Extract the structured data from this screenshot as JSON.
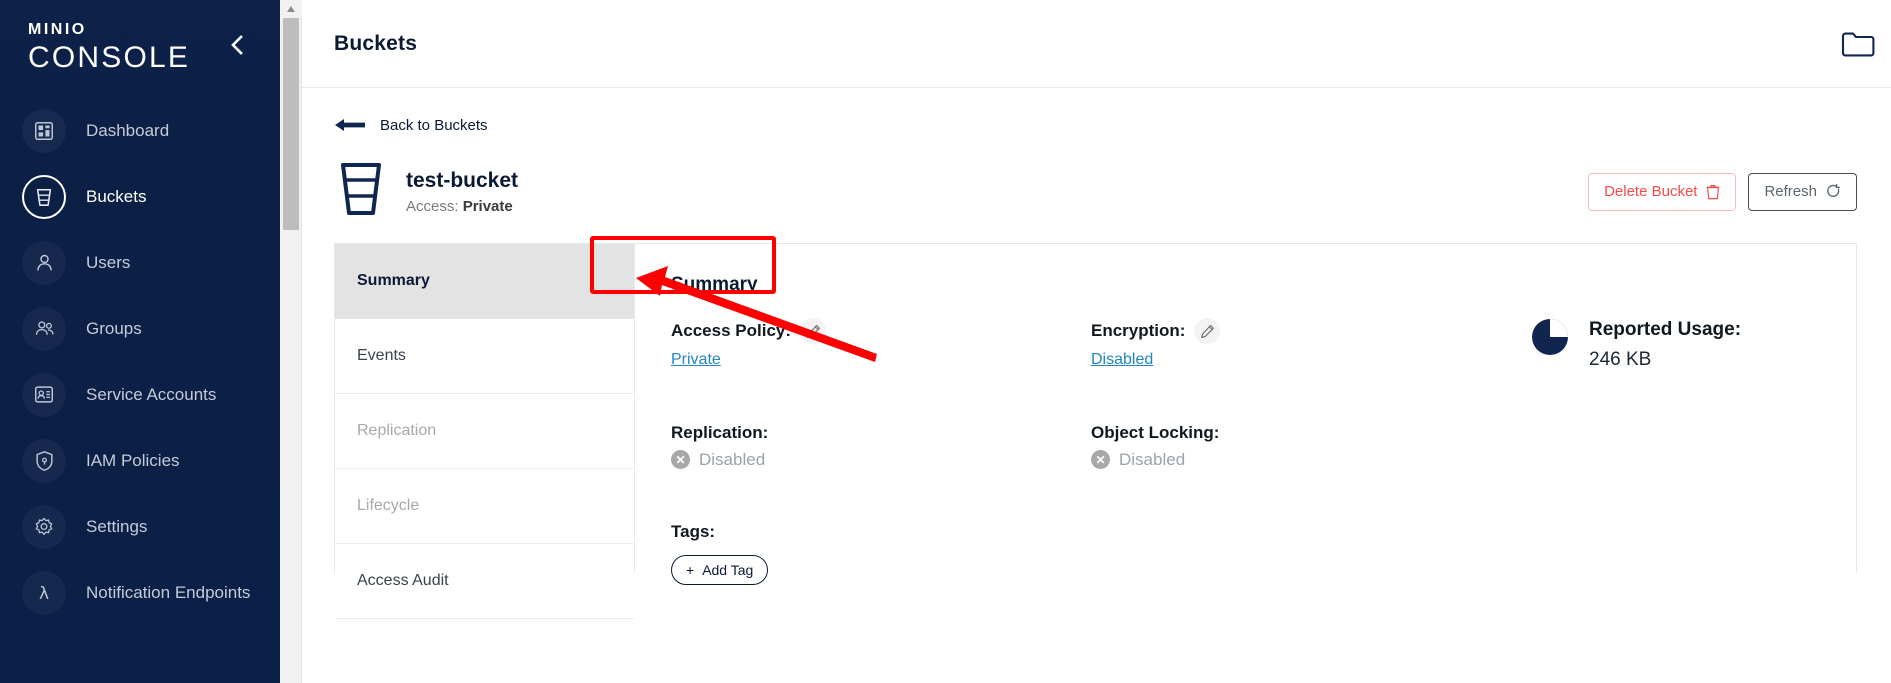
{
  "sidebar": {
    "logo_top": "MINIO",
    "logo_bottom": "CONSOLE",
    "collapse_icon": "chevron-left-icon",
    "items": [
      {
        "label": "Dashboard",
        "icon": "dashboard-icon",
        "active": false
      },
      {
        "label": "Buckets",
        "icon": "bucket-icon",
        "active": true
      },
      {
        "label": "Users",
        "icon": "user-icon",
        "active": false
      },
      {
        "label": "Groups",
        "icon": "groups-icon",
        "active": false
      },
      {
        "label": "Service Accounts",
        "icon": "service-account-icon",
        "active": false
      },
      {
        "label": "IAM Policies",
        "icon": "shield-lock-icon",
        "active": false
      },
      {
        "label": "Settings",
        "icon": "gear-icon",
        "active": false
      },
      {
        "label": "Notification Endpoints",
        "icon": "lambda-icon",
        "active": false
      }
    ]
  },
  "header": {
    "title": "Buckets",
    "right_icon": "folder-icon"
  },
  "back_link": {
    "label": "Back to Buckets",
    "icon": "arrow-left-icon"
  },
  "bucket": {
    "icon": "bucket-icon",
    "name": "test-bucket",
    "access_prefix": "Access:",
    "access_value": "Private"
  },
  "actions": {
    "delete_label": "Delete Bucket",
    "delete_icon": "trash-icon",
    "refresh_label": "Refresh",
    "refresh_icon": "refresh-icon"
  },
  "tabs": [
    {
      "label": "Summary",
      "active": true,
      "disabled": false
    },
    {
      "label": "Events",
      "active": false,
      "disabled": false
    },
    {
      "label": "Replication",
      "active": false,
      "disabled": true
    },
    {
      "label": "Lifecycle",
      "active": false,
      "disabled": true
    },
    {
      "label": "Access Audit",
      "active": false,
      "disabled": false
    }
  ],
  "summary": {
    "title": "Summary",
    "access_policy": {
      "label": "Access Policy:",
      "edit_icon": "pencil-icon",
      "value": "Private"
    },
    "encryption": {
      "label": "Encryption:",
      "edit_icon": "pencil-icon",
      "value": "Disabled"
    },
    "reported_usage": {
      "label": "Reported Usage:",
      "value": "246 KB",
      "icon": "pie-chart-icon"
    },
    "replication": {
      "label": "Replication:",
      "value": "Disabled",
      "status_icon": "x-circle-icon"
    },
    "object_locking": {
      "label": "Object Locking:",
      "value": "Disabled",
      "status_icon": "x-circle-icon"
    },
    "tags": {
      "label": "Tags:",
      "add_label": "Add Tag",
      "add_icon": "plus-icon"
    }
  },
  "annotations": {
    "highlight_color": "#ff0000",
    "box_target": "access-policy-field",
    "arrow_target": "access-policy-private-link"
  },
  "colors": {
    "sidebar_bg": "#0c2049",
    "accent_link": "#2186c4",
    "danger": "#f24d4d",
    "title": "#0b1a34"
  }
}
